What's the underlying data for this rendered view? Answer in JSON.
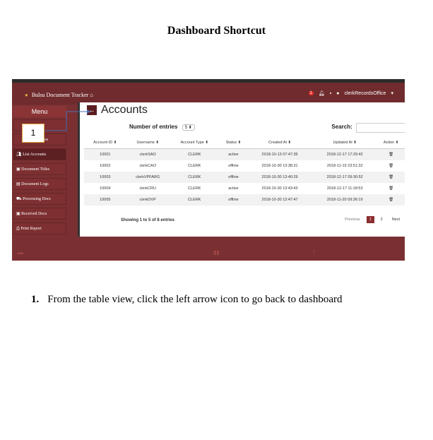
{
  "doc": {
    "title": "Dashboard Shortcut",
    "step_number": "1.",
    "step_text": "From the table view, click the  left arrow icon to go back to dashboard"
  },
  "app": {
    "brand": "Bulsu Document Tracker",
    "user": "clerkRecordsOffice",
    "notif_count": "1",
    "colors": {
      "header": "#6f2b2d",
      "sidebar": "#7d2f31",
      "accent": "#8b2d2f"
    }
  },
  "sidebar": {
    "menu_label": "Menu",
    "items": [
      {
        "label": "...yees",
        "icon": "users-icon"
      },
      {
        "label": "List Accounts",
        "icon": "users-icon"
      },
      {
        "label": "Document Titles",
        "icon": "doc-icon"
      },
      {
        "label": "Document Logs",
        "icon": "list-icon"
      },
      {
        "label": "Processing Docs",
        "icon": "truck-icon"
      },
      {
        "label": "Received Docs",
        "icon": "doc-icon"
      },
      {
        "label": "Print Report",
        "icon": "print-icon"
      }
    ]
  },
  "callout": {
    "label": "1"
  },
  "accounts": {
    "title": "Accounts",
    "entries_label": "Number of entries",
    "entries_value": "5",
    "search_label": "Search:",
    "columns": [
      "Account ID",
      "Username",
      "Account Type",
      "Status",
      "Created At",
      "Updated At",
      "Action"
    ],
    "rows": [
      [
        "10001",
        "clerkSAO",
        "CLERK",
        "active",
        "2018-10-13 07:47:35",
        "2018-12-17 17:29:42"
      ],
      [
        "10002",
        "clerkCAO",
        "CLERK",
        "offline",
        "2018-10-30 13:38:31",
        "2018-11-19 23:51:32"
      ],
      [
        "10003",
        "clerkVPFARG",
        "CLERK",
        "offline",
        "2018-10-30 13:40:29",
        "2018-12-17 09:30:52"
      ],
      [
        "10004",
        "clerkCRU",
        "CLERK",
        "active",
        "2018-10-30 13:43:43",
        "2018-12-17 11:18:53"
      ],
      [
        "10005",
        "clerkOVP",
        "CLERK",
        "offline",
        "2018-10-30 13:47:47",
        "2018-11-20 09:36:19"
      ]
    ],
    "footer": "Showing 1 to 5 of 8 entries",
    "pager": {
      "prev": "Previous",
      "pages": [
        "1",
        "2"
      ],
      "next": "Next"
    }
  }
}
